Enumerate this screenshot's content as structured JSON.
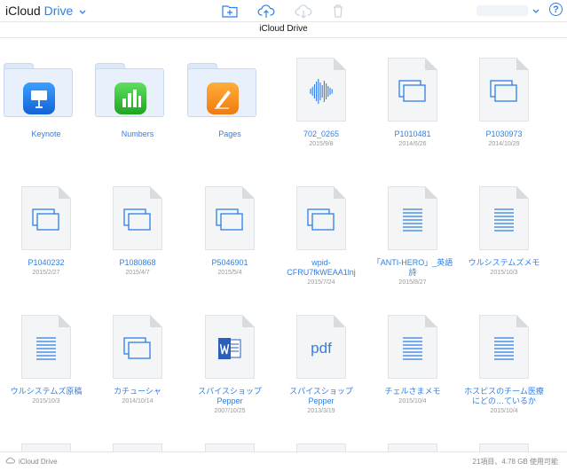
{
  "header": {
    "brand_primary": "iCloud",
    "brand_secondary": "Drive",
    "help_label": "?",
    "toolbar_icons": [
      "new-folder-icon",
      "upload-icon",
      "download-icon",
      "trash-icon"
    ]
  },
  "subbar": {
    "title": "iCloud Drive"
  },
  "items": [
    {
      "name": "Keynote",
      "date": "",
      "type": "folder",
      "app": "keynote"
    },
    {
      "name": "Numbers",
      "date": "",
      "type": "folder",
      "app": "numbers"
    },
    {
      "name": "Pages",
      "date": "",
      "type": "folder",
      "app": "pages"
    },
    {
      "name": "702_0265",
      "date": "2015/9/8",
      "type": "audio"
    },
    {
      "name": "P1010481",
      "date": "2014/6/26",
      "type": "image"
    },
    {
      "name": "P1030973",
      "date": "2014/10/29",
      "type": "image"
    },
    {
      "name": "P1040232",
      "date": "2015/2/27",
      "type": "image"
    },
    {
      "name": "P1080868",
      "date": "2015/4/7",
      "type": "image"
    },
    {
      "name": "P5046901",
      "date": "2015/5/4",
      "type": "image"
    },
    {
      "name": "wpid-CFRU7fkWEAA1lnj",
      "date": "2015/7/24",
      "type": "image"
    },
    {
      "name": "「ANTI-HERO」_英語詩",
      "date": "2015/8/27",
      "type": "text"
    },
    {
      "name": "ウルシステムズメモ",
      "date": "2015/10/3",
      "type": "text"
    },
    {
      "name": "ウルシステムズ原稿",
      "date": "2015/10/3",
      "type": "text"
    },
    {
      "name": "カチューシャ",
      "date": "2014/10/14",
      "type": "image"
    },
    {
      "name": "スパイスショップPepper",
      "date": "2007/10/25",
      "type": "word"
    },
    {
      "name": "スパイスショップPepper",
      "date": "2013/3/19",
      "type": "pdf",
      "glyph_text": "pdf"
    },
    {
      "name": "チェルさまメモ",
      "date": "2015/10/4",
      "type": "text"
    },
    {
      "name": "ホスピスのチーム医療にどの…ているか",
      "date": "2015/10/4",
      "type": "text"
    }
  ],
  "status": {
    "location": "iCloud Drive",
    "summary": "21項目、4.78 GB 使用可能"
  },
  "colors": {
    "accent": "#2f7fe6",
    "folder": "#e8f1fb",
    "doc": "#f4f5f7"
  }
}
